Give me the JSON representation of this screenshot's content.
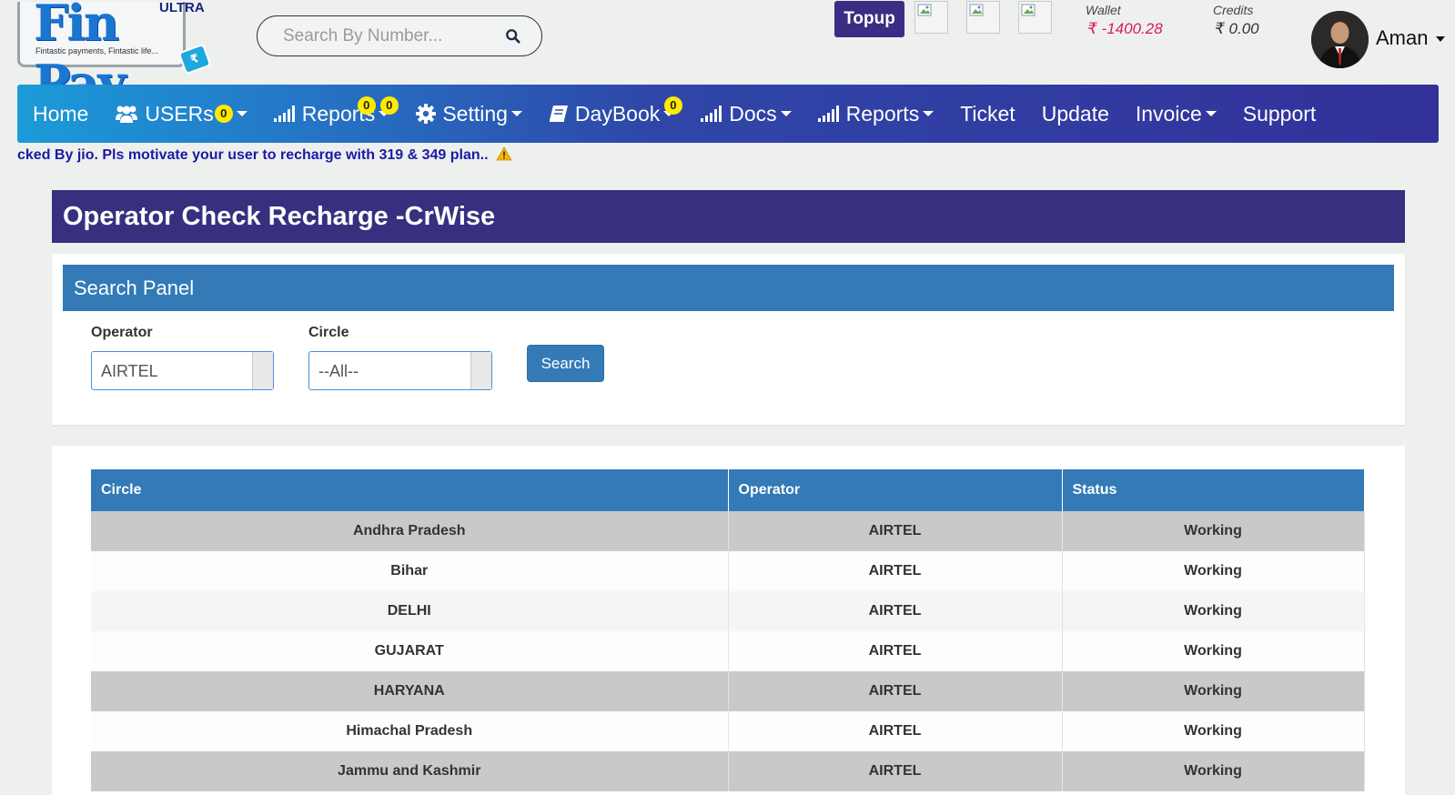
{
  "brand": {
    "name": "Fin Pay",
    "tier": "ULTRA",
    "tagline": "Fintastic payments, Fintastic life..."
  },
  "search": {
    "placeholder": "Search By Number...",
    "value": ""
  },
  "header": {
    "topup_label": "Topup",
    "wallet_label": "Wallet",
    "wallet_value": "₹ -1400.28",
    "credits_label": "Credits",
    "credits_value": "₹ 0.00",
    "user_name": "Aman"
  },
  "nav": {
    "home": "Home",
    "users": "USERs",
    "users_badge": "0",
    "reports1": "Reports",
    "reports1_badge_a": "0",
    "reports1_badge_b": "0",
    "setting": "Setting",
    "daybook": "DayBook",
    "daybook_badge": "0",
    "docs": "Docs",
    "reports2": "Reports",
    "ticket": "Ticket",
    "update": "Update",
    "invoice": "Invoice",
    "support": "Support"
  },
  "announcement": "cked By jio. Pls motivate your user to recharge with 319 & 349 plan..",
  "page": {
    "title": "Operator Check Recharge -CrWise"
  },
  "search_panel": {
    "title": "Search Panel",
    "operator_label": "Operator",
    "operator_value": "AIRTEL",
    "circle_label": "Circle",
    "circle_value": "--All--",
    "search_button": "Search"
  },
  "table": {
    "headers": [
      "Circle",
      "Operator",
      "Status"
    ],
    "rows": [
      {
        "circle": "Andhra Pradesh",
        "operator": "AIRTEL",
        "status": "Working"
      },
      {
        "circle": "Bihar",
        "operator": "AIRTEL",
        "status": "Working"
      },
      {
        "circle": "DELHI",
        "operator": "AIRTEL",
        "status": "Working"
      },
      {
        "circle": "GUJARAT",
        "operator": "AIRTEL",
        "status": "Working"
      },
      {
        "circle": "HARYANA",
        "operator": "AIRTEL",
        "status": "Working"
      },
      {
        "circle": "Himachal Pradesh",
        "operator": "AIRTEL",
        "status": "Working"
      },
      {
        "circle": "Jammu and Kashmir",
        "operator": "AIRTEL",
        "status": "Working"
      }
    ]
  },
  "colors": {
    "nav_start": "#1b9bd8",
    "nav_end": "#33319a",
    "title_bar": "#37307f",
    "panel_blue": "#337ab7",
    "wallet_negative": "#d81b60",
    "badge": "#ffea00"
  },
  "icons": [
    "search-icon",
    "users-icon",
    "signal-icon",
    "gear-icon",
    "book-icon",
    "warning-icon",
    "broken-image-icon"
  ]
}
